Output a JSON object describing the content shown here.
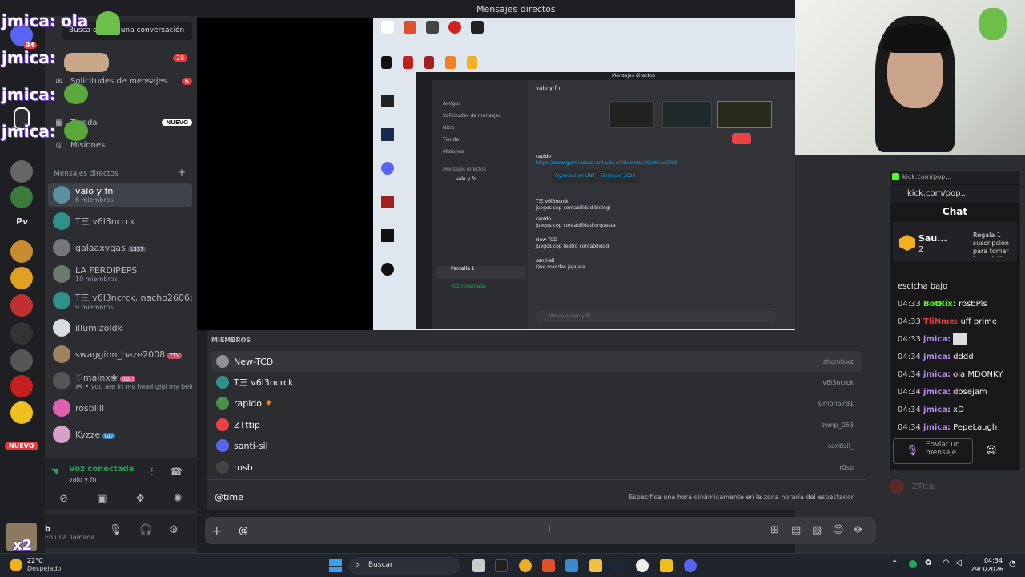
{
  "window": {
    "title": "Mensajes directos"
  },
  "sidebar": {
    "search_placeholder": "Busca o inicia una conversación",
    "requests_label": "Solicitudes de mensajes",
    "requests_count": "6",
    "shop_label": "Tienda",
    "shop_badge": "NUEVO",
    "missions_label": "Misiones",
    "dm_header": "Mensajes directos",
    "dms": [
      {
        "name": "valo y fn",
        "sub": "6 miembros"
      },
      {
        "name": "T三 v6l3ncrck",
        "sub": ""
      },
      {
        "name": "galaaxygas",
        "sub": "",
        "tag": "1337"
      },
      {
        "name": "LA FERDIPEPS",
        "sub": "10 miembros"
      },
      {
        "name": "T三 v6l3ncrck, nacho2606b, B...",
        "sub": "9 miembros"
      },
      {
        "name": "illumizoldk",
        "sub": ""
      },
      {
        "name": "swagginn_haze2008",
        "sub": "",
        "tag": "7TV"
      },
      {
        "name": "♡mainx❀",
        "sub": "🎮 • you are in my head gigi my belov...",
        "tag": "osu!"
      },
      {
        "name": "rosbiiii",
        "sub": ""
      },
      {
        "name": "Kyzze",
        "sub": "",
        "tag": "GD"
      }
    ],
    "voice": {
      "status": "Voz conectada",
      "channel": "valo y fn"
    },
    "user": {
      "name": "b",
      "status": "En una llamada"
    }
  },
  "overlay": {
    "chat_user": "jmica:",
    "chat_msg": "ola",
    "badge_28": "28",
    "badge_34": "34",
    "new_label": "NUEVO"
  },
  "members": {
    "header": "MIEMBROS",
    "list": [
      {
        "name": "New-TCD",
        "username": "shombixz",
        "color": "#8e9297"
      },
      {
        "name": "T三 v6l3ncrck",
        "username": "v6l3ncrck",
        "color": "#2f8f8a"
      },
      {
        "name": "rapido",
        "username": "simon6781",
        "color": "#4a8f4a"
      },
      {
        "name": "ZTttip",
        "username": "zwnp_053",
        "color": "#ed4245"
      },
      {
        "name": "santi-sil",
        "username": "santisil_",
        "color": "#5865f2"
      },
      {
        "name": "rosb",
        "username": "r0sb",
        "color": "#444"
      }
    ],
    "time_cmd": "@time",
    "time_desc": "Especifica una hora dinámicamente en la zona horaria del espectador"
  },
  "composer": {
    "value": "@"
  },
  "kick": {
    "url": "kick.com/pop...",
    "tab": "kick.com/pop...",
    "chat_title": "Chat",
    "gift_user": "Sau...",
    "gift_count": "2",
    "gift_text": "Regala 1 suscripción para tomar la posición",
    "messages": [
      {
        "time": "",
        "user": "",
        "text": "escicha bajo"
      },
      {
        "time": "04:33",
        "user": "BotRix:",
        "text": "rosbPls"
      },
      {
        "time": "04:33",
        "user": "TliNme:",
        "text": "uff prime"
      },
      {
        "time": "04:33",
        "user": "jmica:",
        "text": ""
      },
      {
        "time": "04:34",
        "user": "jmica:",
        "text": "dddd"
      },
      {
        "time": "04:34",
        "user": "jmica:",
        "text": "ola MDONKY"
      },
      {
        "time": "04:34",
        "user": "jmica:",
        "text": "dosejam"
      },
      {
        "time": "04:34",
        "user": "jmica:",
        "text": "xD"
      },
      {
        "time": "04:34",
        "user": "jmica:",
        "text": "PepeLaugh"
      }
    ],
    "send_placeholder": "Enviar un mensaje",
    "ghost_user": "ZTttip"
  },
  "taskbar": {
    "weather_temp": "22°C",
    "weather_desc": "Despejado",
    "search": "Buscar",
    "time": "04:34",
    "date": "29/3/2026",
    "user_label": "x2"
  },
  "inner": {
    "title": "Mensajes directos",
    "channel": "valo y fn",
    "friends": "Amigos",
    "requests": "Solicitudes de mensajes",
    "nitro": "Nitro",
    "shop": "Tienda",
    "missions": "Misiones",
    "dm_header": "Mensajes directos",
    "voice": "Voz conectada",
    "screen": "Pantalla 1",
    "msgs": [
      {
        "user": "rapido",
        "text": "https://www.gymnasium.unt.edu.ar/alumnos/electivas2026"
      },
      {
        "user": "T三 v6l3ncrck",
        "text": "juegos cop contabilidad biologi"
      },
      {
        "user": "rapido",
        "text": "juegos cop contabilidad orquesta"
      },
      {
        "user": "New-TCD",
        "text": "Juegos cop teatro contabilidad"
      },
      {
        "user": "santi-sil",
        "text": "Que mandas jajajaja"
      }
    ],
    "link_card": "Gymnasium UNT - Electivas 2026",
    "composer": "Mensaje valo y fn"
  },
  "colors": {
    "accent": "#5865f2",
    "danger": "#ed4245",
    "kick": "#53fc18",
    "jmica": "#b48cf2"
  }
}
